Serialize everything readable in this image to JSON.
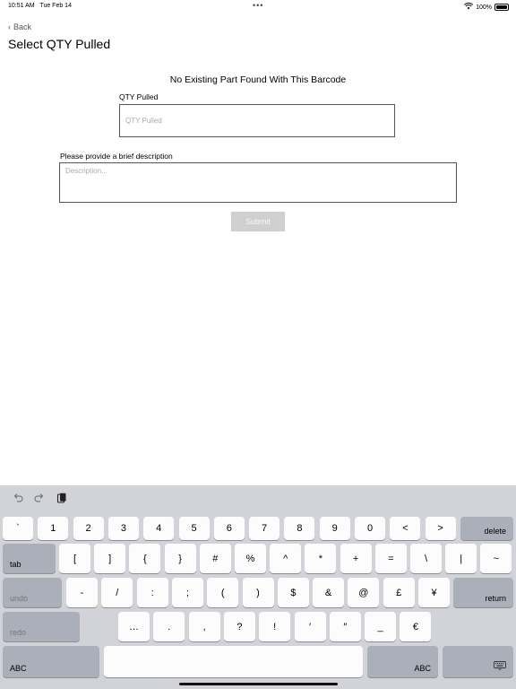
{
  "status": {
    "time": "10:51 AM",
    "date": "Tue Feb 14",
    "battery": "100%",
    "dots": "•••"
  },
  "nav": {
    "back_label": "Back",
    "title": "Select QTY Pulled"
  },
  "form": {
    "heading": "No Existing Part Found With This Barcode",
    "qty_label": "QTY Pulled",
    "qty_placeholder": "QTY Pulled",
    "desc_label": "Please provide a brief description",
    "desc_placeholder": "Description...",
    "submit_label": "Submit"
  },
  "keyboard": {
    "row1": [
      "`",
      "1",
      "2",
      "3",
      "4",
      "5",
      "6",
      "7",
      "8",
      "9",
      "0",
      "<",
      ">"
    ],
    "delete": "delete",
    "tab": "tab",
    "row2": [
      "[",
      "]",
      "{",
      "}",
      "#",
      "%",
      "^",
      "*",
      "+",
      "=",
      "\\",
      "|",
      "~"
    ],
    "undo": "undo",
    "row3": [
      "-",
      "/",
      ":",
      ";",
      "(",
      ")",
      "$",
      "&",
      "@",
      "£",
      "¥"
    ],
    "return": "return",
    "redo": "redo",
    "row4": [
      "…",
      ".",
      ",",
      "?",
      "!",
      "′",
      "″",
      "_",
      "€"
    ],
    "abc_left": "ABC",
    "abc_right": "ABC"
  }
}
